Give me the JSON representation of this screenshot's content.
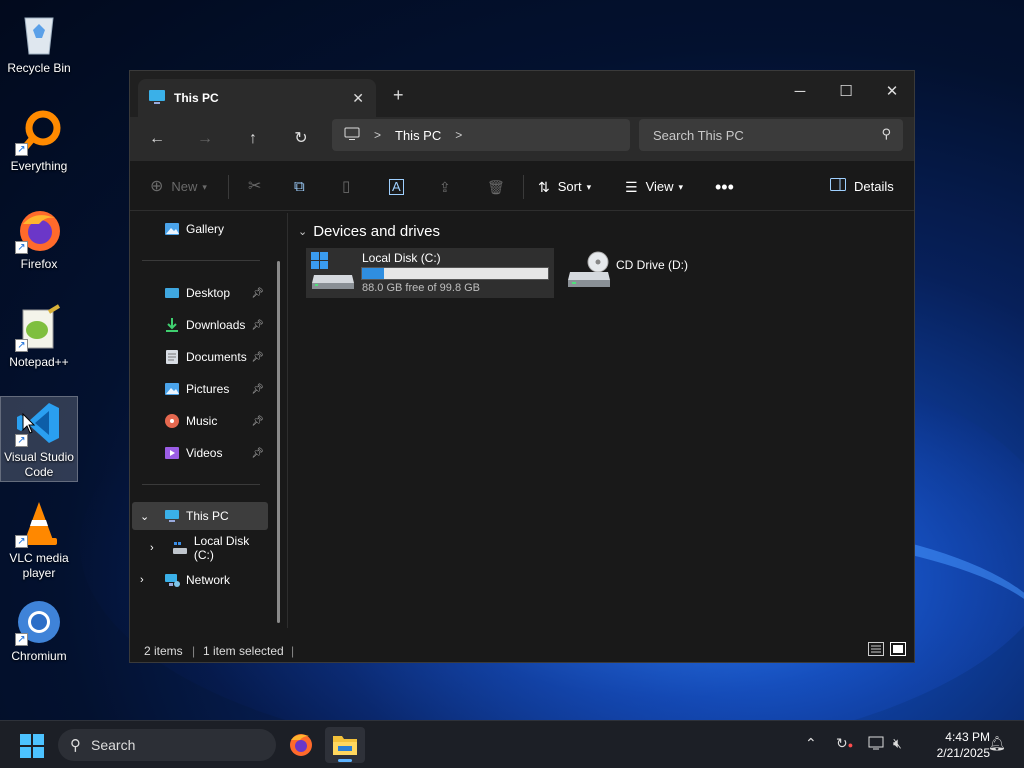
{
  "desktop": {
    "icons": [
      {
        "label": "Recycle Bin"
      },
      {
        "label": "Everything"
      },
      {
        "label": "Firefox"
      },
      {
        "label": "Notepad++"
      },
      {
        "label": "Visual Studio Code"
      },
      {
        "label": "VLC media player"
      },
      {
        "label": "Chromium"
      }
    ]
  },
  "window": {
    "tab_title": "This PC",
    "address": {
      "segment": "This PC"
    },
    "search_placeholder": "Search This PC",
    "toolbar": {
      "new_label": "New",
      "sort_label": "Sort",
      "view_label": "View",
      "details_label": "Details"
    },
    "sidebar": {
      "gallery": "Gallery",
      "quick_access": [
        {
          "label": "Desktop"
        },
        {
          "label": "Downloads"
        },
        {
          "label": "Documents"
        },
        {
          "label": "Pictures"
        },
        {
          "label": "Music"
        },
        {
          "label": "Videos"
        }
      ],
      "this_pc": "This PC",
      "local_disk": "Local Disk (C:)",
      "network": "Network"
    },
    "content": {
      "group_header": "Devices and drives",
      "drives": [
        {
          "name": "Local Disk (C:)",
          "free_text": "88.0 GB free of 99.8 GB",
          "used_fraction": 0.118
        },
        {
          "name": "CD Drive (D:)"
        }
      ]
    },
    "status": {
      "items": "2 items",
      "selected": "1 item selected"
    }
  },
  "taskbar": {
    "search_label": "Search",
    "time": "4:43 PM",
    "date": "2/21/2025"
  },
  "colors": {
    "accent": "#2f8ee0",
    "window_bg": "#191919",
    "titlebar_bg": "#202020"
  }
}
